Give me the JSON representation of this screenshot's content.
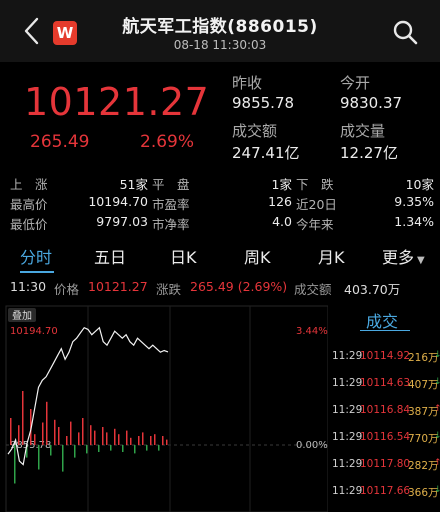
{
  "header": {
    "title": "航天军工指数(886015)",
    "subtitle": "08-18 11:30:03",
    "logo_text": "W"
  },
  "quote": {
    "price": "10121.27",
    "change": "265.49",
    "change_pct": "2.69%",
    "prev_close_label": "昨收",
    "prev_close": "9855.78",
    "open_label": "今开",
    "open": "9830.37",
    "turnover_label": "成交额",
    "turnover": "247.41亿",
    "volume_label": "成交量",
    "volume": "12.27亿"
  },
  "stats": {
    "up_label": "上　涨",
    "up_value": "51家",
    "flat_label": "平　盘",
    "flat_value": "1家",
    "down_label": "下　跌",
    "down_value": "10家",
    "high_label": "最高价",
    "high_value": "10194.70",
    "pe_label": "市盈率",
    "pe_value": "126",
    "d20_label": "近20日",
    "d20_value": "9.35%",
    "low_label": "最低价",
    "low_value": "9797.03",
    "pb_label": "市净率",
    "pb_value": "4.0",
    "ytd_label": "今年来",
    "ytd_value": "1.34%"
  },
  "tabs": [
    "分时",
    "五日",
    "日K",
    "周K",
    "月K",
    "更多"
  ],
  "info": {
    "time": "11:30",
    "price_label": "价格",
    "price": "10121.27",
    "change_label": "涨跌",
    "change": "265.49 (2.69%)",
    "amount_label": "成交额",
    "amount": "403.70万"
  },
  "chart": {
    "overlay_label": "叠加",
    "top_price": "10194.70",
    "top_pct": "3.44%",
    "base_price": "9855.78",
    "base_pct": "0.00%"
  },
  "side": {
    "title": "成交",
    "trades": [
      {
        "time": "11:29",
        "price": "10114.92",
        "vol": "216万",
        "dir": "↓"
      },
      {
        "time": "11:29",
        "price": "10114.63",
        "vol": "407万",
        "dir": "↓"
      },
      {
        "time": "11:29",
        "price": "10116.84",
        "vol": "387万",
        "dir": "↑"
      },
      {
        "time": "11:29",
        "price": "10116.54",
        "vol": "770万",
        "dir": "↓"
      },
      {
        "time": "11:29",
        "price": "10117.80",
        "vol": "282万",
        "dir": "↑"
      },
      {
        "time": "11:29",
        "price": "10117.66",
        "vol": "366万",
        "dir": "↓"
      }
    ]
  },
  "colors": {
    "up": "#e5353a",
    "down": "#2fa34a",
    "accent": "#4aa8e0",
    "volume_text": "#e0b04a"
  },
  "icons": {
    "back": "chevron-left-icon",
    "search": "search-icon"
  },
  "chart_data": {
    "type": "line",
    "y_range": [
      9855.78,
      10194.7
    ],
    "series": [
      {
        "values": [
          9830,
          9845,
          9870,
          9810,
          9800,
          9860,
          9900,
          9960,
          10020,
          10040,
          10050,
          10070,
          10090,
          10110,
          10130,
          10100,
          10120,
          10150,
          10160,
          10175,
          10190,
          10185,
          10170,
          10180,
          10190,
          10150,
          10140,
          10160,
          10180,
          10170,
          10160,
          10170,
          10150,
          10140,
          10160,
          10150,
          10140,
          10130,
          10140,
          10130,
          10120,
          10125,
          10121
        ]
      }
    ]
  }
}
